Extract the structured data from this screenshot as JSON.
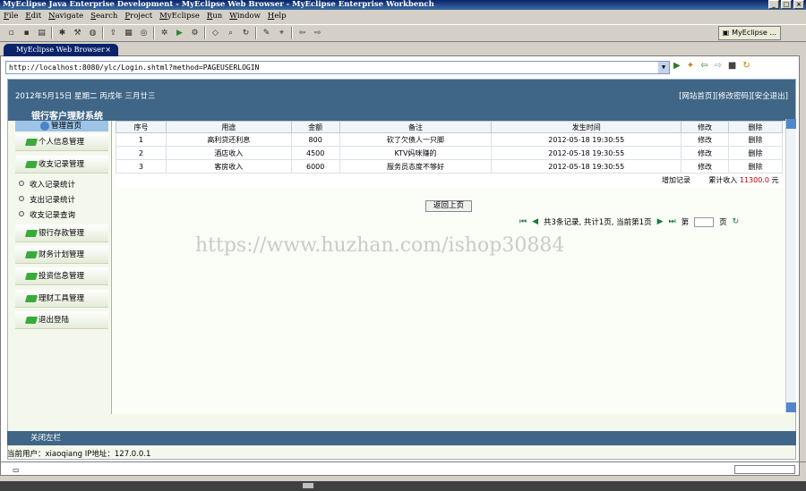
{
  "window": {
    "title": "MyEclipse Java Enterprise Development - MyEclipse Web Browser - MyEclipse Enterprise Workbench"
  },
  "menu": [
    "File",
    "Edit",
    "Navigate",
    "Search",
    "Project",
    "MyEclipse",
    "Run",
    "Window",
    "Help"
  ],
  "perspective": {
    "label": "MyEclipse ..."
  },
  "editor_tab": {
    "label": "MyEclipse Web Browser",
    "close": "×"
  },
  "browser": {
    "url": "http://localhost:8080/ylc/Login.shtml?method=PAGEUSERLOGIN"
  },
  "header": {
    "date": "2012年5月15日 星期二 丙戌年 三月廿三",
    "links": "[网站首页][修改密码][安全退出]",
    "system_title": "银行客户理财系统"
  },
  "sidebar": {
    "home": "管理首页",
    "items": [
      "个人信息管理",
      "收支记录管理",
      "银行存款管理",
      "财务计划管理",
      "投资信息管理",
      "理财工具管理",
      "退出登陆"
    ],
    "subitems": [
      "收入记录统计",
      "支出记录统计",
      "收支记录查询"
    ]
  },
  "table": {
    "headers": [
      "序号",
      "用途",
      "金额",
      "备注",
      "发生时间",
      "修改",
      "删除"
    ],
    "rows": [
      [
        "1",
        "高利贷还利息",
        "800",
        "砍了欠债人一只脚",
        "2012-05-18 19:30:55",
        "修改",
        "删除"
      ],
      [
        "2",
        "酒店收入",
        "4500",
        "KTV妈咪赚的",
        "2012-05-18 19:30:55",
        "修改",
        "删除"
      ],
      [
        "3",
        "客房收入",
        "6000",
        "服务员态度不够好",
        "2012-05-18 19:30:55",
        "修改",
        "删除"
      ]
    ],
    "add_label": "增加记录",
    "total_label": "累计收入",
    "total_value": "11300.0",
    "currency": "元"
  },
  "back_button": "返回上页",
  "pager": {
    "summary": "共3条记录, 共计1页, 当前第1页",
    "page_prefix": "第",
    "page_suffix": "页"
  },
  "watermark": "https://www.huzhan.com/ishop30884",
  "footer": {
    "close_left": "关闭左栏"
  },
  "status": {
    "user": "当前用户：xiaoqiang  IP地址：127.0.0.1"
  }
}
